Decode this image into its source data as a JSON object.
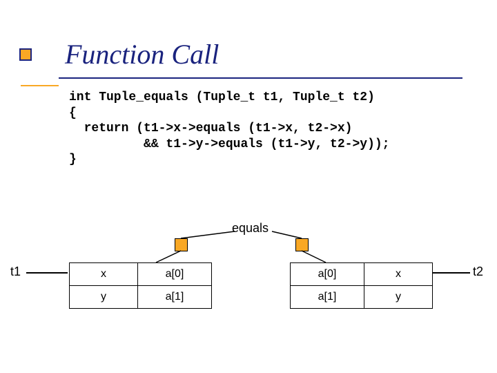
{
  "title": "Function Call",
  "code": "int Tuple_equals (Tuple_t t1, Tuple_t t2)\n{\n  return (t1->x->equals (t1->x, t2->x)\n          && t1->y->equals (t1->y, t2->y));\n}",
  "diagram": {
    "equals_label": "equals",
    "left_pointer": "t1",
    "right_pointer": "t2",
    "t1_rows": [
      {
        "field": "x",
        "value": "a[0]"
      },
      {
        "field": "y",
        "value": "a[1]"
      }
    ],
    "t2_rows": [
      {
        "field": "x",
        "value": "a[0]"
      },
      {
        "field": "y",
        "value": "a[1]"
      }
    ]
  }
}
